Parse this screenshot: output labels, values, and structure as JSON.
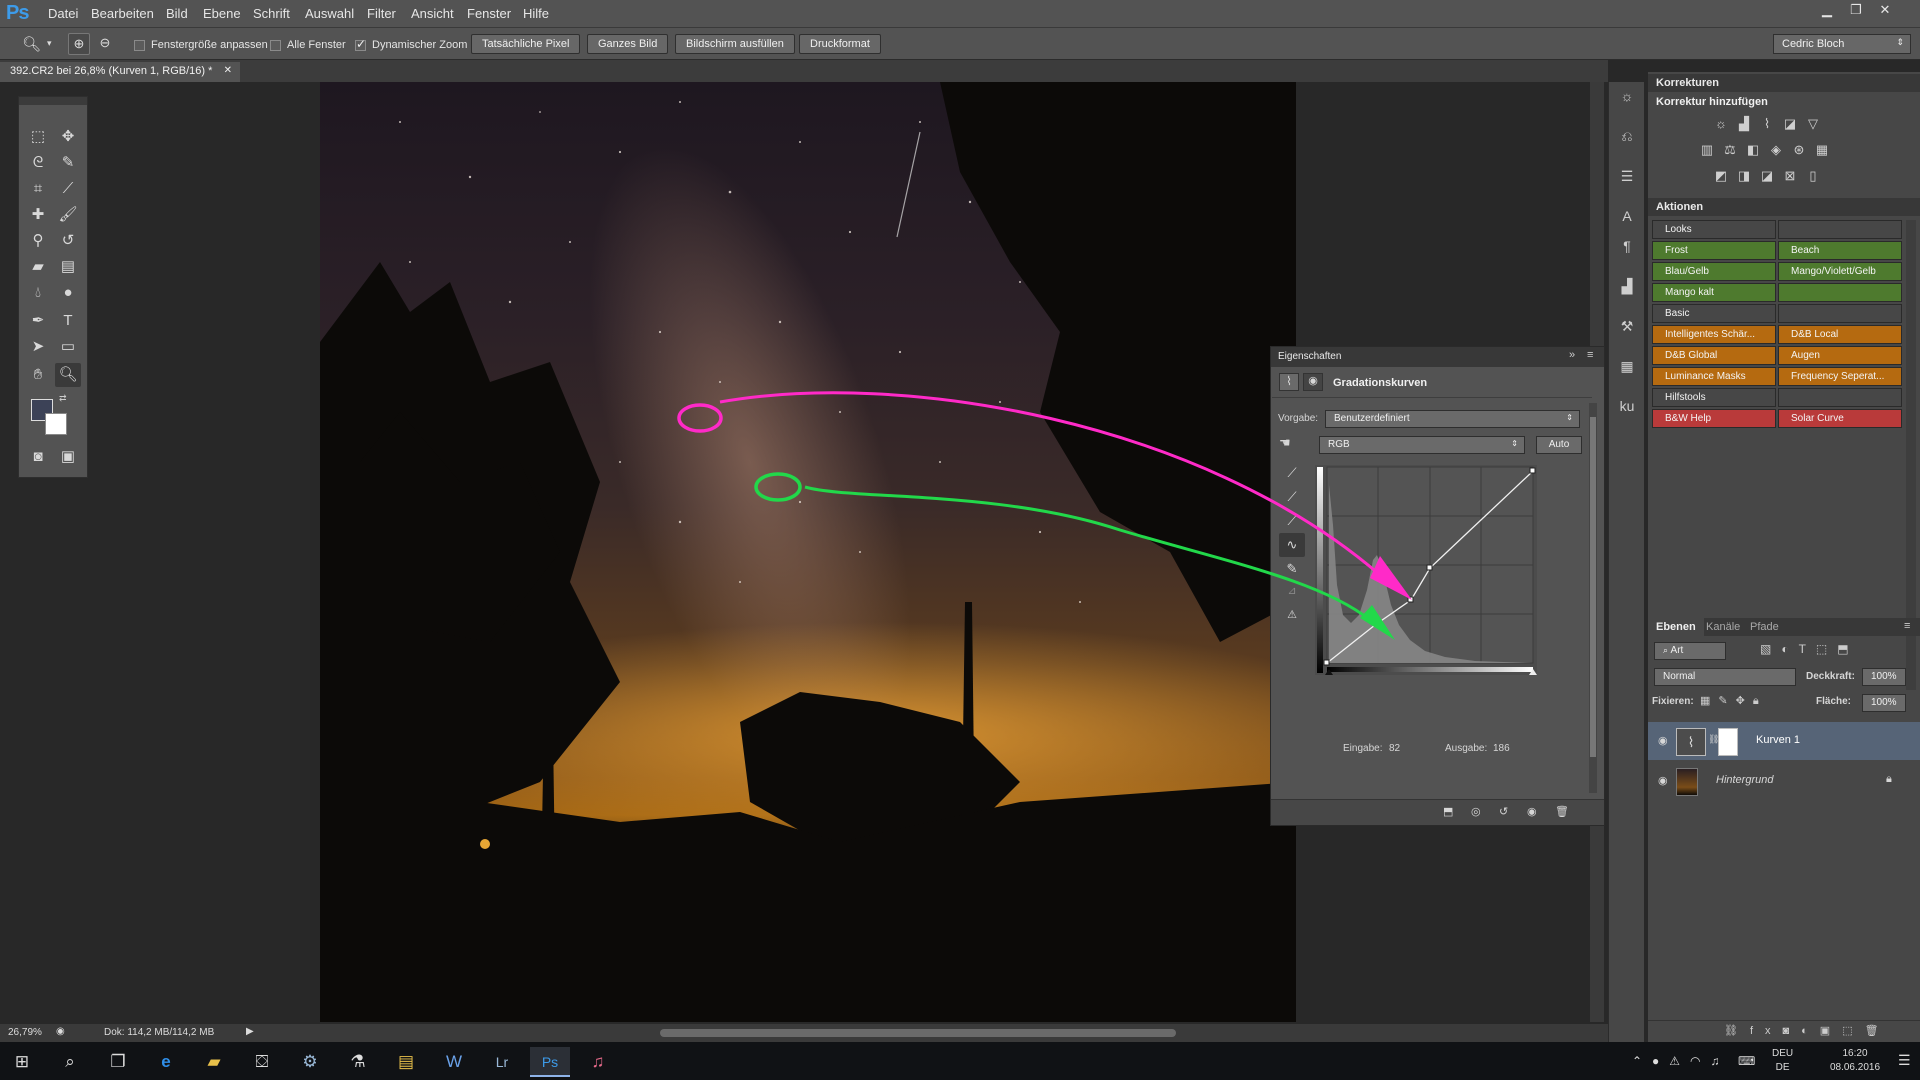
{
  "app": {
    "logo": "Ps",
    "accent": "#3d9be9"
  },
  "menu": [
    "Datei",
    "Bearbeiten",
    "Bild",
    "Ebene",
    "Schrift",
    "Auswahl",
    "Filter",
    "Ansicht",
    "Fenster",
    "Hilfe"
  ],
  "options": {
    "fit_window": "Fenstergröße anpassen",
    "all_windows": "Alle Fenster",
    "dynamic_zoom": "Dynamischer Zoom",
    "buttons": [
      "Tatsächliche Pixel",
      "Ganzes Bild",
      "Bildschirm ausfüllen",
      "Druckformat"
    ],
    "user": "Cedric Bloch"
  },
  "document": {
    "tab_title": "392.CR2 bei 26,8% (Kurven 1, RGB/16) *"
  },
  "status": {
    "zoom": "26,79%",
    "doc": "Dok: 114,2 MB/114,2 MB"
  },
  "korrekturen": {
    "title": "Korrekturen",
    "subtitle": "Korrektur hinzufügen"
  },
  "aktionen": {
    "title": "Aktionen",
    "rows": [
      {
        "left": "Looks",
        "right": "",
        "color": "#474747"
      },
      {
        "left": "Frost",
        "right": "Beach",
        "color": "#4e7a2e"
      },
      {
        "left": "Blau/Gelb",
        "right": "Mango/Violett/Gelb",
        "color": "#4e7a2e"
      },
      {
        "left": "Mango kalt",
        "right": "",
        "color": "#4e7a2e"
      },
      {
        "left": "Basic",
        "right": "",
        "color": "#474747"
      },
      {
        "left": "Intelligentes Schär...",
        "right": "D&B Local",
        "color": "#b56a10"
      },
      {
        "left": "D&B Global",
        "right": "Augen",
        "color": "#b56a10"
      },
      {
        "left": "Luminance Masks",
        "right": "Frequency Seperat...",
        "color": "#b56a10"
      },
      {
        "left": "Hilfstools",
        "right": "",
        "color": "#474747"
      },
      {
        "left": "B&W Help",
        "right": "Solar Curve",
        "color": "#b93a3a"
      }
    ]
  },
  "eigenschaften": {
    "title": "Eigenschaften",
    "panel_name": "Gradationskurven",
    "vorgabe_label": "Vorgabe:",
    "vorgabe_value": "Benutzerdefiniert",
    "channel": "RGB",
    "auto": "Auto",
    "eingabe_label": "Eingabe:",
    "eingabe_value": "82",
    "ausgabe_label": "Ausgabe:",
    "ausgabe_value": "186"
  },
  "ebenen": {
    "tabs": [
      "Ebenen",
      "Kanäle",
      "Pfade"
    ],
    "filter": "Art",
    "blend_mode": "Normal",
    "opacity_label": "Deckkraft:",
    "opacity": "100%",
    "lock_label": "Fixieren:",
    "fill_label": "Fläche:",
    "fill": "100%",
    "layers": [
      {
        "name": "Kurven 1",
        "selected": true
      },
      {
        "name": "Hintergrund",
        "selected": false
      }
    ]
  },
  "taskbar": {
    "lang": "DEU",
    "region": "DE",
    "time": "16:20",
    "date": "08.06.2016"
  }
}
